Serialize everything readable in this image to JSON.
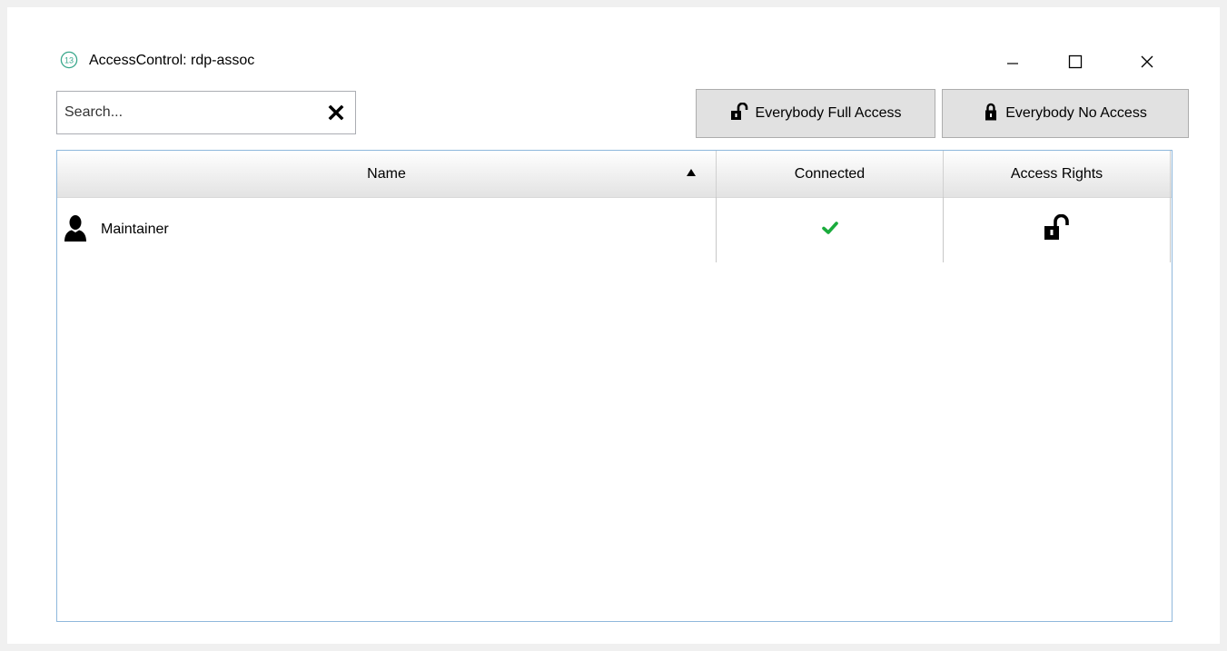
{
  "window": {
    "title": "AccessControl: rdp-assoc",
    "app_icon": "app-logo-icon",
    "controls": [
      "minimize-icon",
      "maximize-icon",
      "close-icon"
    ]
  },
  "search": {
    "placeholder": "Search...",
    "value": "",
    "clear_icon": "clear-x-icon"
  },
  "toolbar": {
    "full_access_label": "Everybody Full Access",
    "full_access_icon": "unlocked-padlock-icon",
    "no_access_label": "Everybody No Access",
    "no_access_icon": "locked-padlock-icon"
  },
  "grid": {
    "columns": [
      {
        "label": "Name",
        "sort": "ascending"
      },
      {
        "label": "Connected"
      },
      {
        "label": "Access Rights"
      }
    ],
    "rows": [
      {
        "name": "Maintainer",
        "icon": "user-silhouette-icon",
        "connected": true,
        "connected_icon": "checkmark-icon",
        "access_rights": "full",
        "access_icon": "unlocked-padlock-icon"
      }
    ]
  },
  "colors": {
    "checkmark": "#1aab3c",
    "grid_border": "#8fb8dc",
    "button_bg": "#e1e1e1"
  }
}
